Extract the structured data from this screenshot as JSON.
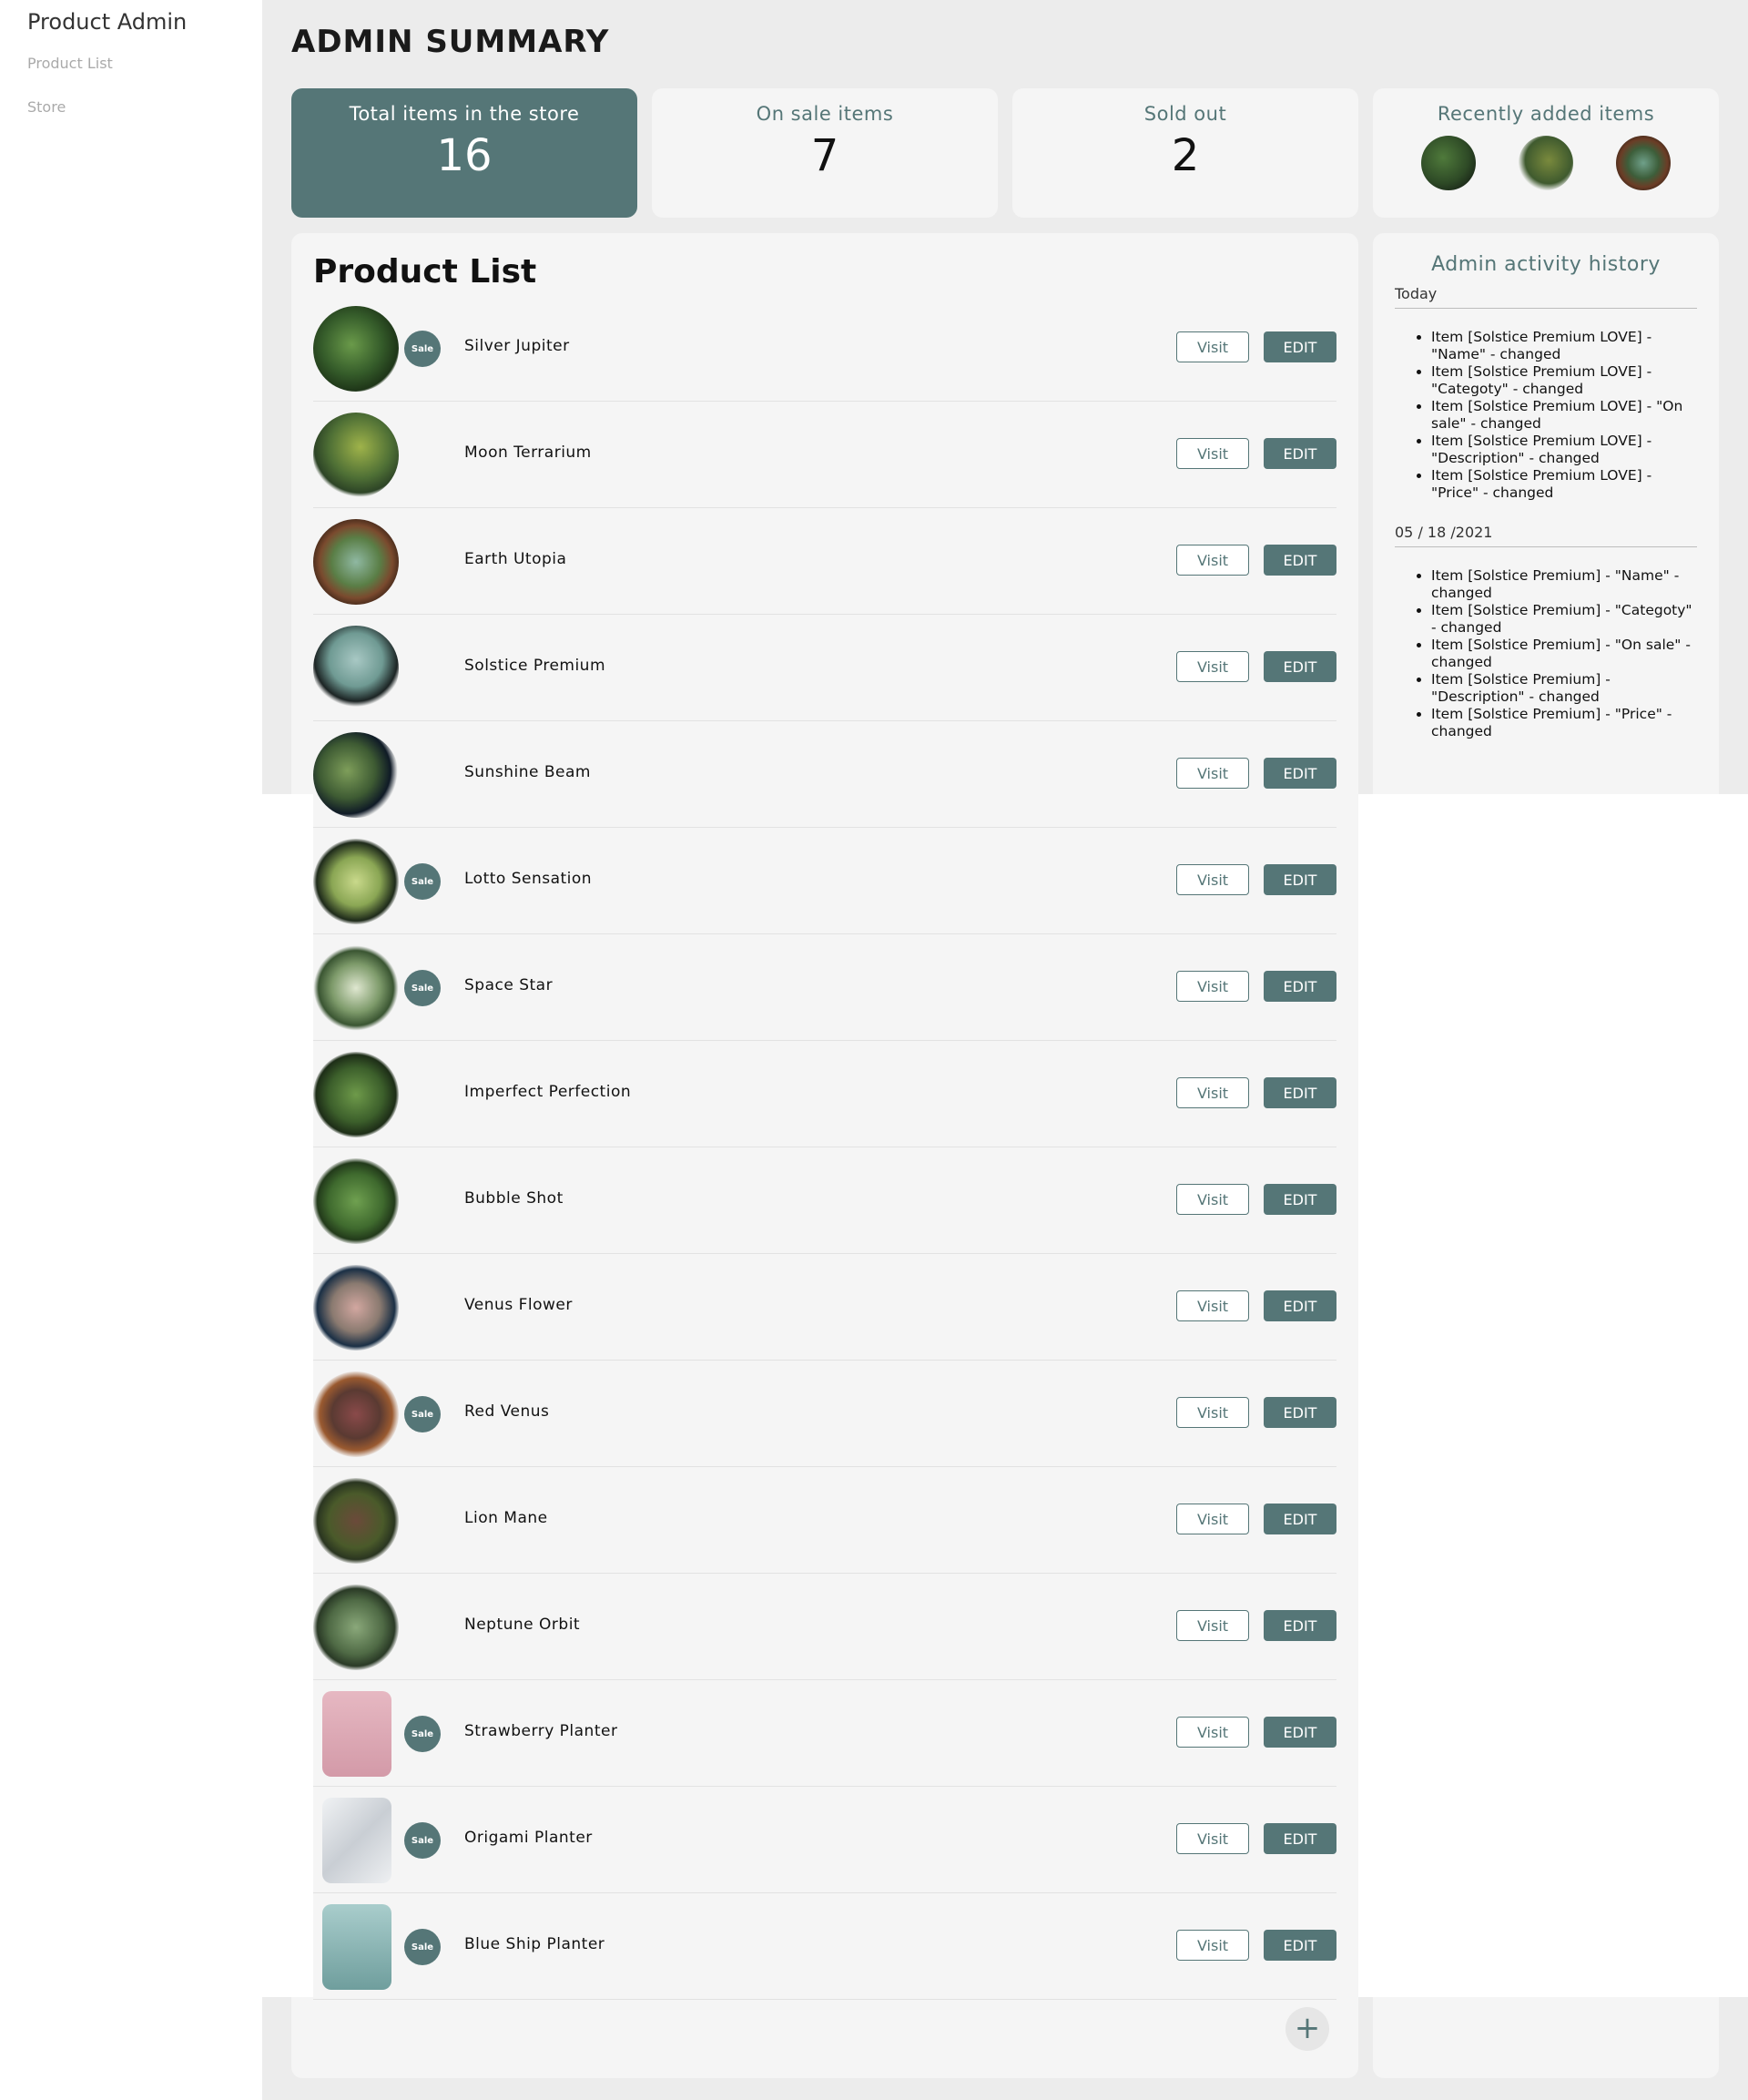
{
  "sidebar": {
    "title": "Product Admin",
    "items": [
      {
        "label": "Product List"
      },
      {
        "label": "Store"
      }
    ]
  },
  "page_title": "ADMIN SUMMARY",
  "stats": [
    {
      "label": "Total items in the store",
      "value": "16"
    },
    {
      "label": "On sale items",
      "value": "7"
    },
    {
      "label": "Sold out",
      "value": "2"
    },
    {
      "label": "Recently added items"
    }
  ],
  "product_list": {
    "title": "Product List",
    "sale_label": "Sale",
    "visit_label": "Visit",
    "edit_label": "EDIT",
    "items": [
      {
        "name": "Silver Jupiter",
        "sale": true
      },
      {
        "name": "Moon Terrarium",
        "sale": false
      },
      {
        "name": "Earth Utopia",
        "sale": false
      },
      {
        "name": "Solstice Premium",
        "sale": false
      },
      {
        "name": "Sunshine Beam",
        "sale": false
      },
      {
        "name": "Lotto Sensation",
        "sale": true
      },
      {
        "name": "Space Star",
        "sale": true
      },
      {
        "name": "Imperfect Perfection",
        "sale": false
      },
      {
        "name": "Bubble Shot",
        "sale": false
      },
      {
        "name": "Venus Flower",
        "sale": false
      },
      {
        "name": "Red Venus",
        "sale": true
      },
      {
        "name": "Lion Mane",
        "sale": false
      },
      {
        "name": "Neptune Orbit",
        "sale": false
      },
      {
        "name": "Strawberry Planter",
        "sale": true
      },
      {
        "name": "Origami Planter",
        "sale": true
      },
      {
        "name": "Blue Ship Planter",
        "sale": true
      }
    ],
    "add_icon": "plus-icon"
  },
  "activity": {
    "title": "Admin activity history",
    "groups": [
      {
        "date": "Today",
        "entries": [
          "Item [Solstice Premium LOVE] - \"Name\" - changed",
          "Item [Solstice Premium LOVE] - \"Categoty\" - changed",
          "Item [Solstice Premium LOVE] - \"On sale\" - changed",
          "Item [Solstice Premium LOVE] - \"Description\" - changed",
          "Item [Solstice Premium LOVE] - \"Price\" - changed"
        ]
      },
      {
        "date": "05 / 18 /2021",
        "entries": [
          "Item [Solstice Premium] - \"Name\" - changed",
          "Item [Solstice Premium] - \"Categoty\" - changed",
          "Item [Solstice Premium] - \"On sale\" - changed",
          "Item [Solstice Premium] - \"Description\" - changed",
          "Item [Solstice Premium] - \"Price\" - changed"
        ]
      }
    ]
  },
  "colors": {
    "accent": "#557677",
    "card_bg": "#f5f5f5",
    "page_bg": "#ececec"
  }
}
